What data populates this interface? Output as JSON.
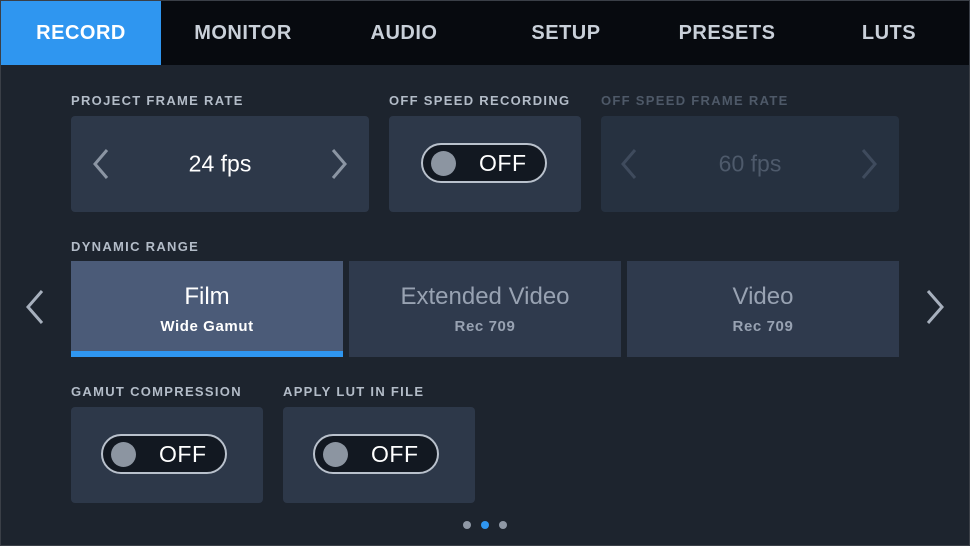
{
  "tabs": [
    {
      "label": "RECORD",
      "active": true
    },
    {
      "label": "MONITOR",
      "active": false
    },
    {
      "label": "AUDIO",
      "active": false
    },
    {
      "label": "SETUP",
      "active": false
    },
    {
      "label": "PRESETS",
      "active": false
    },
    {
      "label": "LUTS",
      "active": false
    }
  ],
  "project_frame_rate": {
    "label": "PROJECT FRAME RATE",
    "value": "24 fps"
  },
  "off_speed_recording": {
    "label": "OFF SPEED RECORDING",
    "state": "OFF"
  },
  "off_speed_frame_rate": {
    "label": "OFF SPEED FRAME RATE",
    "value": "60 fps",
    "enabled": false
  },
  "dynamic_range": {
    "label": "DYNAMIC RANGE",
    "options": [
      {
        "name": "Film",
        "sub": "Wide Gamut",
        "selected": true
      },
      {
        "name": "Extended Video",
        "sub": "Rec 709",
        "selected": false
      },
      {
        "name": "Video",
        "sub": "Rec 709",
        "selected": false
      }
    ]
  },
  "gamut_compression": {
    "label": "GAMUT COMPRESSION",
    "state": "OFF"
  },
  "apply_lut_in_file": {
    "label": "APPLY LUT IN FILE",
    "state": "OFF"
  },
  "pagination": {
    "pages": 3,
    "current": 2
  },
  "colors": {
    "accent": "#2f96f0",
    "tabbar": "#070a0f",
    "background": "#1d242e",
    "card": "#2d3849",
    "selected_card": "#4b5b78"
  }
}
